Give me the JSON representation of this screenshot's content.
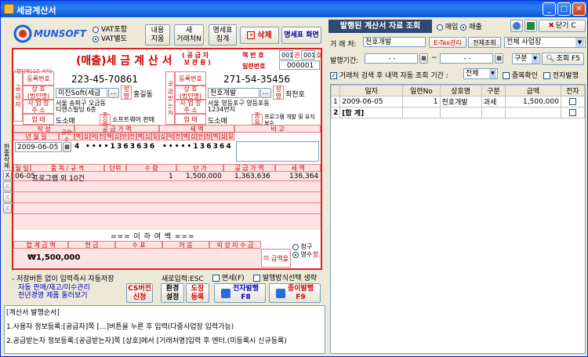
{
  "window": {
    "title": "세금계산서"
  },
  "toolbar": {
    "logo": "MUNSOFT",
    "vat_included": "VAT포함",
    "vat_separate": "VAT별도",
    "content_reset": "내용\n지움",
    "new_customer": "새\n거래처N",
    "detail_total": "명세표\n집계",
    "delete": "삭제",
    "detail_screen": "명세표 화면"
  },
  "invoice": {
    "title": "(매출)세 금 계 산 서",
    "copy_note": "( 공 급 자\n 보 관 용 )",
    "book_no_label": "책 번 호",
    "book_no_1": "001",
    "book_no_mid": "권",
    "book_no_2": "001",
    "book_no_end": "호",
    "serial_label": "일련번호",
    "serial": "000001",
    "vendor_label": "(별지제11호 서식)",
    "supplier_side": "공 급 자",
    "receiver_side": "공 급 받 는 자",
    "reg_label": "등록번호",
    "supplier_reg": "223-45-70861",
    "receiver_reg": "271-54-35456",
    "company_label": "상 호\n(법인명)",
    "supplier_company": "미진Soft(세금",
    "receiver_company": "천호개발",
    "name_label": "성명",
    "supplier_name": "홍길동",
    "receiver_name": "최천호",
    "address_label": "사 업 장\n주 소",
    "supplier_address": "서울 송파구 오금동\n디엔스빌딩 6층",
    "receiver_address": "서울 영등포구 영등포동\n1234번지",
    "biz_type_label": "업 태",
    "item_label": "종목",
    "supplier_biz_type": "도소매",
    "supplier_item": "소프트웨어 판매",
    "receiver_biz_type": "도소매",
    "receiver_item": "프로그램 개발 및 유지보수",
    "written_label": "작 성",
    "supply_amount_label": "공 급 가 액",
    "tax_label": "세 액",
    "remark_label": "비 고",
    "ymd_label": "년 월 일",
    "blank_label": "공란수",
    "digits": [
      "백",
      "십",
      "억",
      "천",
      "백",
      "십",
      "만",
      "천",
      "백",
      "십",
      "일"
    ],
    "tax_digits": [
      "십",
      "억",
      "천",
      "백",
      "십",
      "만",
      "천",
      "백",
      "십",
      "일"
    ],
    "date": "2009-06-05",
    "blank_count": "4",
    "supply_amount_digits": "• • • • 1 3 6 3 6 3 6",
    "tax_amount_digits": "• • • • • 1 3 6 3 6 4",
    "side_label": "한줄삭제",
    "col_month_day": "월 일",
    "col_item": "품 목 / 규 격",
    "col_unit": "단위",
    "col_qty": "수 량",
    "col_price": "단 가",
    "col_supply": "공 급 가 액",
    "col_tax": "세 액",
    "line1_date": "06-05",
    "line1_item": "프로그램 외 10건",
    "line1_qty": "1",
    "line1_price": "1,500,000",
    "line1_supply": "1,363,636",
    "line1_tax": "136,364",
    "eq_text": "=== 이 하 여 백 ===",
    "total_label": "합 계 금 액",
    "cash_label": "현 금",
    "check_label": "수 표",
    "note_label": "어 음",
    "credit_label": "외 상 미 수 금",
    "total_amount": "₩1,500,000",
    "amount_text": "이 금액을",
    "claim": "청구",
    "receipt": "영수",
    "ham": "함."
  },
  "bottom": {
    "hint_auto_save": "- 저장버튼 없이 입력즉시 자동저장",
    "new_input": "새로입력:ESC",
    "tax_free": "면세(F)",
    "issue_method": "발행방식선택 생략",
    "link1": "자동 판매/재고/미수관리",
    "link2": "천년경영 제품 둘러보기",
    "cs_btn": "CS버전\n신청",
    "env_btn": "환경\n설정",
    "stamp_btn": "도장\n등록",
    "e_issue": "전자발행\nF8",
    "paper_issue": "종이발행\nF9",
    "steps": [
      "[계산서 발행순서]",
      "1.사용자 정보등록:[공급자]쪽 [...]버튼을 누른 후 입력(다중사업장 입력가능)",
      "2.공급받는자 정보등록:[공급받는자]쪽 [상호]에서 [거래처명]입력 후 엔터.(미등록시 신규등록)"
    ]
  },
  "right": {
    "header": "발행된 계산서 자료 조회",
    "purchase": "매입",
    "sales": "매출",
    "close": "닫기 C",
    "customer_label": "거 래 처:",
    "customer_value": "천호개발",
    "etax": "E-Tax관리",
    "all_query": "전체조회",
    "site": "전체 사업장",
    "period_label": "발행기간:",
    "date_from": "- -",
    "date_to": "- -",
    "category": "구분",
    "query": "조회 F5",
    "auto_query": "거래처 검색 후 내역 자동 조회 기간 :",
    "period_sel": "전체",
    "dup_check": "중복확인",
    "e_issue": "전자발행",
    "columns": [
      "일자",
      "일련No",
      "상호명",
      "구분",
      "금액",
      "전자"
    ],
    "rows": [
      {
        "no": "1",
        "date": "2009-06-05",
        "serial": "1",
        "name": "천호개발",
        "type": "과세",
        "amount": "1,500,000"
      }
    ],
    "total_row": "2",
    "total_label": "[합 계]"
  },
  "colors": {
    "accent": "#e02020",
    "title": "#0b58d6",
    "pink": "#fde3e3"
  }
}
